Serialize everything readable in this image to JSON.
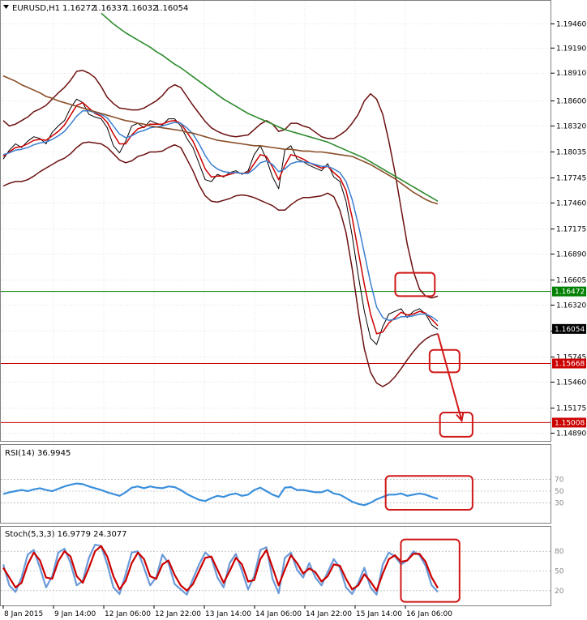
{
  "chart_data": [
    {
      "type": "line",
      "panel": "price",
      "header": {
        "symbol": "EURUSD,H1",
        "ohlc": [
          "1.16272",
          "1.16337",
          "1.16032",
          "1.16054"
        ]
      },
      "y_ticks": [
        1.1946,
        1.1919,
        1.1891,
        1.186,
        1.1832,
        1.1803,
        1.1774,
        1.1746,
        1.1717,
        1.1689,
        1.166,
        1.1632,
        1.1603,
        1.1574,
        1.1546,
        1.1517,
        1.1489
      ],
      "y_tick_labels": [
        "1.19460",
        "1.19190",
        "1.18910",
        "1.18600",
        "1.18320",
        "1.18035",
        "1.17745",
        "1.17460",
        "1.17175",
        "1.16890",
        "1.16605",
        "1.16320",
        "1.16035",
        "1.15745",
        "1.15460",
        "1.15175",
        "1.14890"
      ],
      "ylim": [
        1.1484,
        1.196
      ],
      "x_ticks": [
        "8 Jan 2015",
        "9 Jan 14:00",
        "12 Jan 06:00",
        "12 Jan 22:00",
        "13 Jan 14:00",
        "14 Jan 06:00",
        "14 Jan 22:00",
        "15 Jan 14:00",
        "16 Jan 06:00"
      ],
      "price_labels": [
        {
          "value": 1.16472,
          "text": "1.16472",
          "color": "#008000"
        },
        {
          "value": 1.16054,
          "text": "1.16054",
          "color": "#000000"
        },
        {
          "value": 1.15668,
          "text": "1.15668",
          "color": "#cc0000"
        },
        {
          "value": 1.15008,
          "text": "1.15008",
          "color": "#cc0000"
        }
      ],
      "horizontal_lines": [
        {
          "value": 1.16472,
          "color": "#008000"
        },
        {
          "value": 1.15668,
          "color": "#cc0000"
        },
        {
          "value": 1.15008,
          "color": "#cc0000"
        }
      ],
      "series": [
        {
          "key": "price",
          "color": "#000000",
          "values": [
            1.1795,
            1.1805,
            1.1812,
            1.1808,
            1.1815,
            1.182,
            1.1818,
            1.1812,
            1.1825,
            1.1832,
            1.1838,
            1.1852,
            1.1862,
            1.1858,
            1.1845,
            1.1842,
            1.184,
            1.183,
            1.181,
            1.1802,
            1.1815,
            1.1832,
            1.1835,
            1.183,
            1.1838,
            1.1835,
            1.1833,
            1.184,
            1.184,
            1.1832,
            1.1818,
            1.1808,
            1.179,
            1.1772,
            1.177,
            1.1778,
            1.1775,
            1.178,
            1.1782,
            1.1778,
            1.1782,
            1.18,
            1.181,
            1.1795,
            1.1775,
            1.1762,
            1.1805,
            1.181,
            1.1795,
            1.1792,
            1.1788,
            1.1785,
            1.1782,
            1.179,
            1.1775,
            1.177,
            1.1748,
            1.171,
            1.1665,
            1.1625,
            1.1595,
            1.1588,
            1.1608,
            1.1622,
            1.1625,
            1.1628,
            1.1618,
            1.1625,
            1.1628,
            1.1622,
            1.161,
            1.1605
          ]
        },
        {
          "key": "ma_fast",
          "color": "#cc0000",
          "values": [
            1.1798,
            1.1803,
            1.1808,
            1.1809,
            1.1812,
            1.1816,
            1.1817,
            1.1816,
            1.1821,
            1.1826,
            1.1833,
            1.1844,
            1.1855,
            1.1858,
            1.1852,
            1.1846,
            1.1843,
            1.1836,
            1.1823,
            1.1812,
            1.1812,
            1.1822,
            1.1829,
            1.1831,
            1.1834,
            1.1834,
            1.1834,
            1.1837,
            1.1838,
            1.1835,
            1.1825,
            1.1815,
            1.18,
            1.1784,
            1.1775,
            1.1776,
            1.1776,
            1.1778,
            1.178,
            1.1779,
            1.178,
            1.179,
            1.18,
            1.1798,
            1.1786,
            1.1772,
            1.1788,
            1.18,
            1.1798,
            1.1795,
            1.1791,
            1.1788,
            1.1785,
            1.1787,
            1.178,
            1.1774,
            1.176,
            1.173,
            1.1692,
            1.1655,
            1.1622,
            1.16,
            1.1602,
            1.1612,
            1.1618,
            1.1624,
            1.1621,
            1.1622,
            1.1625,
            1.1623,
            1.1616,
            1.1609
          ]
        },
        {
          "key": "ma_mid",
          "color": "#3a7fd0",
          "values": [
            1.18,
            1.1802,
            1.1805,
            1.1806,
            1.1808,
            1.1811,
            1.1813,
            1.1814,
            1.1817,
            1.1821,
            1.1826,
            1.1834,
            1.1843,
            1.1849,
            1.1849,
            1.1847,
            1.1845,
            1.1841,
            1.1832,
            1.1823,
            1.1819,
            1.1821,
            1.1825,
            1.1827,
            1.183,
            1.1831,
            1.1832,
            1.1834,
            1.1836,
            1.1835,
            1.183,
            1.1823,
            1.1812,
            1.1799,
            1.1789,
            1.1784,
            1.1781,
            1.178,
            1.178,
            1.1779,
            1.1779,
            1.1784,
            1.1791,
            1.1793,
            1.1789,
            1.1781,
            1.1784,
            1.179,
            1.1792,
            1.1792,
            1.1791,
            1.1789,
            1.1787,
            1.1787,
            1.1784,
            1.178,
            1.177,
            1.175,
            1.1722,
            1.169,
            1.1657,
            1.163,
            1.1618,
            1.1615,
            1.1616,
            1.1619,
            1.1619,
            1.162,
            1.1622,
            1.1622,
            1.1619,
            1.1614
          ]
        },
        {
          "key": "bb_upper",
          "color": "#6b1010",
          "values": [
            1.1838,
            1.1832,
            1.1834,
            1.1838,
            1.1842,
            1.1848,
            1.1851,
            1.1855,
            1.1862,
            1.1869,
            1.1875,
            1.1883,
            1.1893,
            1.1894,
            1.1891,
            1.1886,
            1.1876,
            1.1864,
            1.1857,
            1.1852,
            1.1851,
            1.185,
            1.185,
            1.1852,
            1.1856,
            1.186,
            1.1866,
            1.1874,
            1.1878,
            1.1875,
            1.1865,
            1.1855,
            1.1846,
            1.1837,
            1.183,
            1.1826,
            1.1823,
            1.1821,
            1.182,
            1.1821,
            1.1822,
            1.1828,
            1.1834,
            1.1838,
            1.1834,
            1.1826,
            1.1828,
            1.1835,
            1.1835,
            1.1832,
            1.183,
            1.1825,
            1.182,
            1.1818,
            1.1818,
            1.1822,
            1.1827,
            1.1835,
            1.1845,
            1.186,
            1.1868,
            1.1862,
            1.1845,
            1.1815,
            1.178,
            1.174,
            1.17,
            1.167,
            1.165,
            1.1642,
            1.164,
            1.1642
          ]
        },
        {
          "key": "bb_lower",
          "color": "#6b1010",
          "values": [
            1.1765,
            1.1768,
            1.177,
            1.177,
            1.1772,
            1.1776,
            1.1781,
            1.1785,
            1.1789,
            1.1793,
            1.1796,
            1.1801,
            1.1808,
            1.1813,
            1.1814,
            1.1813,
            1.1812,
            1.1808,
            1.1801,
            1.1794,
            1.1791,
            1.1793,
            1.1798,
            1.18,
            1.1803,
            1.1803,
            1.1804,
            1.1808,
            1.1811,
            1.1808,
            1.1795,
            1.1782,
            1.1766,
            1.1754,
            1.1748,
            1.1747,
            1.1749,
            1.1751,
            1.1754,
            1.1755,
            1.1754,
            1.1752,
            1.1749,
            1.1746,
            1.1743,
            1.1738,
            1.1738,
            1.1744,
            1.1749,
            1.1752,
            1.1752,
            1.1753,
            1.1754,
            1.1757,
            1.1753,
            1.1738,
            1.1713,
            1.1673,
            1.1625,
            1.1583,
            1.1557,
            1.1545,
            1.1541,
            1.1545,
            1.1552,
            1.1561,
            1.1571,
            1.158,
            1.1588,
            1.1594,
            1.1598,
            1.16
          ]
        },
        {
          "key": "ma_slow_brown",
          "color": "#8b4f2a",
          "values": [
            1.1888,
            1.1885,
            1.1882,
            1.1878,
            1.1875,
            1.1872,
            1.1869,
            1.1865,
            1.1863,
            1.186,
            1.1858,
            1.1856,
            1.1854,
            1.1852,
            1.185,
            1.1848,
            1.1846,
            1.1844,
            1.1842,
            1.184,
            1.1838,
            1.1837,
            1.1835,
            1.1834,
            1.1832,
            1.1831,
            1.183,
            1.1829,
            1.1828,
            1.1827,
            1.1825,
            1.1824,
            1.1822,
            1.182,
            1.1818,
            1.1816,
            1.1815,
            1.1814,
            1.1813,
            1.1812,
            1.1811,
            1.181,
            1.181,
            1.1809,
            1.1808,
            1.1807,
            1.1806,
            1.1806,
            1.1805,
            1.1804,
            1.1804,
            1.1803,
            1.1803,
            1.1802,
            1.1801,
            1.18,
            1.1799,
            1.1798,
            1.1795,
            1.1792,
            1.1789,
            1.1785,
            1.1781,
            1.1777,
            1.1773,
            1.1768,
            1.1763,
            1.1758,
            1.1754,
            1.175,
            1.1747,
            1.1745
          ]
        },
        {
          "key": "ma_slowest_green",
          "color": "#2e8b2e",
          "values": [
            null,
            null,
            null,
            null,
            null,
            null,
            null,
            null,
            null,
            null,
            null,
            null,
            null,
            null,
            null,
            null,
            1.1958,
            1.1952,
            1.1946,
            1.1941,
            1.1936,
            1.1932,
            1.1928,
            1.1924,
            1.192,
            1.1915,
            1.1911,
            1.1906,
            1.1901,
            1.1897,
            1.1892,
            1.1887,
            1.1882,
            1.1877,
            1.1872,
            1.1867,
            1.1862,
            1.1858,
            1.1854,
            1.185,
            1.1846,
            1.1843,
            1.184,
            1.1837,
            1.1834,
            1.1831,
            1.1828,
            1.1826,
            1.1824,
            1.1822,
            1.182,
            1.1818,
            1.1816,
            1.1814,
            1.1811,
            1.1808,
            1.1805,
            1.1802,
            1.1799,
            1.1796,
            1.1792,
            1.1788,
            1.1784,
            1.178,
            1.1776,
            1.1772,
            1.1768,
            1.1764,
            1.176,
            1.1756,
            1.1752,
            1.1748
          ]
        }
      ],
      "annotations": {
        "boxes": [
          {
            "x0": 0.902,
            "x1": 0.993,
            "y0": 1.1668,
            "y1": 1.1642
          },
          {
            "x0": 0.981,
            "x1": 1.05,
            "y0": 1.1582,
            "y1": 1.1557
          },
          {
            "x0": 1.005,
            "x1": 1.08,
            "y0": 1.1512,
            "y1": 1.1485
          }
        ],
        "arrow": {
          "x0": 1.0,
          "y0": 1.16,
          "x1": 1.055,
          "y1": 1.1503
        }
      }
    },
    {
      "type": "line",
      "panel": "rsi",
      "title": "RSI(14) 36.9945",
      "ylim": [
        0,
        100
      ],
      "levels": [
        70,
        50,
        30
      ],
      "level_labels": [
        "70",
        "50",
        "30"
      ],
      "series": [
        {
          "key": "rsi",
          "color": "#3a8fdc",
          "values": [
            45,
            48,
            50,
            52,
            50,
            53,
            55,
            52,
            50,
            54,
            58,
            61,
            63,
            62,
            58,
            55,
            52,
            48,
            45,
            42,
            48,
            56,
            58,
            55,
            58,
            56,
            55,
            58,
            57,
            52,
            45,
            40,
            35,
            33,
            38,
            42,
            40,
            44,
            46,
            42,
            44,
            52,
            56,
            50,
            44,
            40,
            56,
            57,
            52,
            52,
            50,
            48,
            48,
            52,
            46,
            44,
            38,
            32,
            28,
            26,
            30,
            36,
            40,
            44,
            44,
            46,
            42,
            44,
            46,
            44,
            40,
            37
          ]
        }
      ],
      "annotations": {
        "box": {
          "x0": 0.88,
          "x1": 1.08,
          "y0": 76,
          "y1": 18
        }
      }
    },
    {
      "type": "line",
      "panel": "stochastic",
      "title": "Stoch(5,3,3) 16.9779 24.3077",
      "ylim": [
        0,
        100
      ],
      "levels": [
        80,
        50,
        20
      ],
      "level_labels": [
        "80",
        "50",
        "20"
      ],
      "series": [
        {
          "key": "stoch_main",
          "color": "#6a9ad8",
          "values": [
            60,
            28,
            18,
            40,
            75,
            82,
            55,
            25,
            42,
            78,
            84,
            62,
            28,
            35,
            70,
            90,
            88,
            60,
            25,
            15,
            45,
            78,
            80,
            55,
            28,
            40,
            75,
            62,
            30,
            22,
            14,
            38,
            60,
            78,
            70,
            40,
            25,
            62,
            76,
            50,
            22,
            42,
            82,
            86,
            38,
            16,
            70,
            78,
            52,
            40,
            62,
            40,
            28,
            48,
            68,
            55,
            25,
            15,
            32,
            55,
            25,
            14,
            60,
            78,
            72,
            60,
            66,
            80,
            74,
            58,
            28,
            18
          ]
        },
        {
          "key": "stoch_signal",
          "color": "#cc0000",
          "values": [
            55,
            40,
            25,
            32,
            60,
            78,
            66,
            40,
            38,
            65,
            80,
            72,
            42,
            32,
            55,
            80,
            88,
            72,
            42,
            22,
            35,
            62,
            78,
            68,
            42,
            38,
            60,
            66,
            44,
            28,
            20,
            30,
            50,
            70,
            72,
            52,
            32,
            50,
            70,
            60,
            34,
            36,
            68,
            82,
            55,
            28,
            52,
            74,
            62,
            46,
            54,
            48,
            34,
            42,
            60,
            58,
            38,
            22,
            28,
            45,
            34,
            20,
            46,
            68,
            74,
            64,
            66,
            76,
            76,
            64,
            40,
            24
          ]
        }
      ],
      "annotations": {
        "box": {
          "x0": 0.915,
          "x1": 1.05,
          "y0": 98,
          "y1": 3
        }
      }
    }
  ]
}
